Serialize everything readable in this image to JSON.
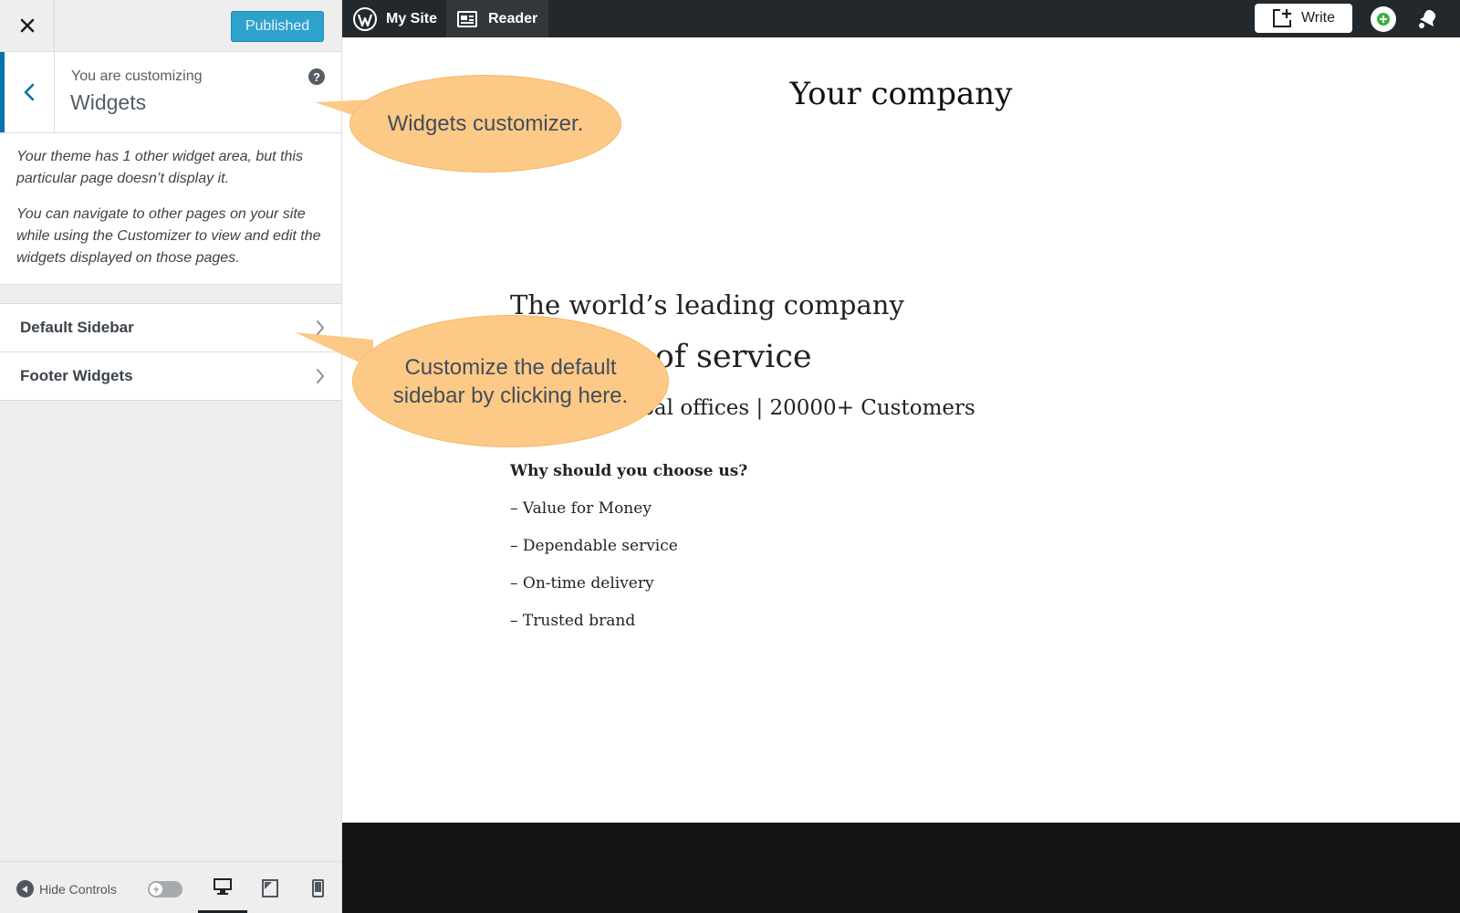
{
  "panel": {
    "publish_label": "Published",
    "customizing_label": "You are customizing",
    "section_title": "Widgets",
    "notice": [
      "Your theme has 1 other widget area, but this particular page doesn’t display it.",
      "You can navigate to other pages on your site while using the Customizer to view and edit the widgets displayed on those pages."
    ],
    "widget_areas": [
      {
        "label": "Default Sidebar"
      },
      {
        "label": "Footer Widgets"
      }
    ],
    "footer": {
      "hide_controls_label": "Hide Controls",
      "devices": [
        "desktop-icon",
        "tablet-icon",
        "mobile-icon"
      ],
      "active_device": "desktop"
    }
  },
  "admin_bar": {
    "my_site_label": "My Site",
    "reader_label": "Reader",
    "write_label": "Write"
  },
  "preview": {
    "site_title": "Your company",
    "headline1": "The world’s leading company",
    "headline2": "us years of service",
    "stats": "es | 29+ Global offices | 20000+ Customers",
    "why_heading": "Why should you choose us?",
    "bullets": [
      "– Value for Money",
      "– Dependable service",
      "– On-time delivery",
      "– Trusted brand"
    ]
  },
  "callouts": {
    "widgets": "Widgets customizer.",
    "sidebar": "Customize the default sidebar by clicking here."
  },
  "colors": {
    "accent": "#0073aa",
    "publish": "#2ea2cc",
    "admin_bar": "#23282d",
    "callout_fill": "#fcc987",
    "preview_footer": "#141414"
  }
}
